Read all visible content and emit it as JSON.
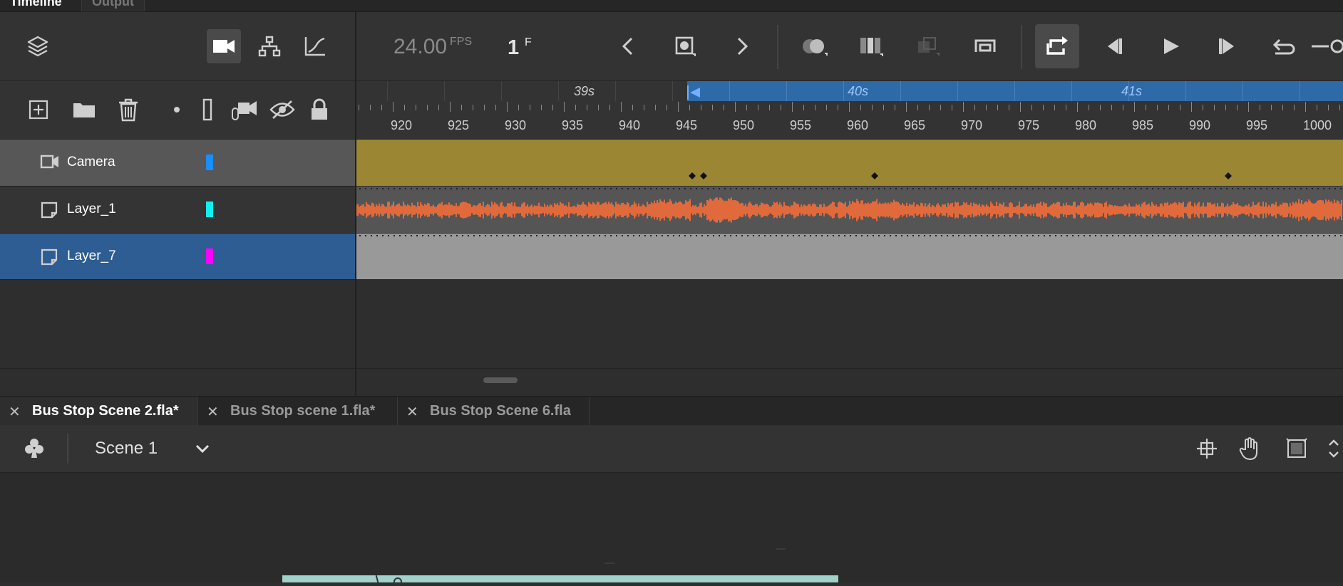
{
  "panel_tabs": {
    "active": "Timeline",
    "inactive": "Output"
  },
  "toolbar": {
    "fps_value": "24.00",
    "fps_unit": "FPS",
    "frame_value": "1",
    "frame_unit": "F",
    "icons": [
      "layers-icon",
      "camera-icon",
      "hierarchy-icon",
      "graph-icon",
      "prev-keyframe-icon",
      "insert-keyframe-icon",
      "next-keyframe-icon",
      "onion-skin-icon",
      "edit-multiple-frames-icon",
      "paste-motion-icon",
      "loop-icon",
      "sync-icon",
      "first-frame-icon",
      "play-icon",
      "last-frame-icon",
      "undo-icon"
    ]
  },
  "layer_tools": [
    "new-layer-icon",
    "new-folder-icon",
    "delete-icon",
    "dot-icon",
    "outline-icon",
    "attach-camera-icon",
    "hide-icon",
    "lock-icon"
  ],
  "ruler": {
    "seconds": [
      "39s",
      "40s",
      "41s"
    ],
    "frame_ticks": [
      "920",
      "925",
      "930",
      "935",
      "940",
      "945",
      "950",
      "955",
      "960",
      "965",
      "970",
      "975",
      "980",
      "985",
      "990",
      "995",
      "1000"
    ]
  },
  "layers": [
    {
      "name": "Camera",
      "color": "#1a8dff",
      "row_bg": "#575757",
      "frames_bg": "#9b8633"
    },
    {
      "name": "Layer_1",
      "color": "#12f0f0",
      "row_bg": "#343434",
      "frames_bg": "#555555"
    },
    {
      "name": "Layer_7",
      "color": "#ff00ff",
      "row_bg": "#2d5d92",
      "frames_bg": "#999999"
    }
  ],
  "doc_tabs": [
    {
      "label": "Bus Stop Scene 2.fla*",
      "active": true
    },
    {
      "label": "Bus Stop scene 1.fla*",
      "active": false
    },
    {
      "label": "Bus Stop Scene 6.fla",
      "active": false
    }
  ],
  "scene": {
    "name": "Scene 1"
  },
  "colors": {
    "accent": "#2f6aa8",
    "waveform": "#e06a3c",
    "keyframe": "#111111"
  }
}
